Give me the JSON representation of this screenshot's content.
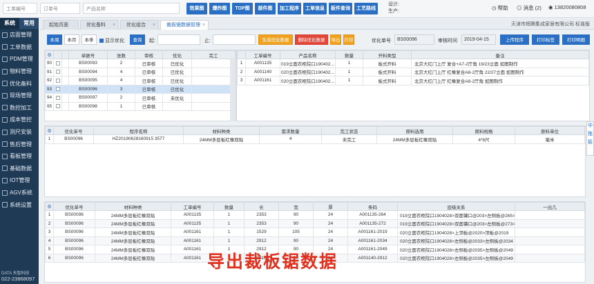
{
  "topbar": {
    "search_order_placeholder": "工单编号",
    "search_order_no_placeholder": "订单号",
    "search_product_placeholder": "产品名称",
    "buttons": [
      "效果图",
      "爆炸图",
      "TOP图",
      "部件图",
      "加工程序",
      "工单信息",
      "板件查询",
      "工艺路线"
    ],
    "design_label": "设计:",
    "production_label": "生产:",
    "help": "帮助",
    "messages": "消息 (2)",
    "user": "13820080808"
  },
  "sidebar": {
    "tabs": [
      "系统",
      "常用"
    ],
    "items": [
      "店面管理",
      "工单数据",
      "PDM管理",
      "物料管理",
      "优化备料",
      "现场管理",
      "数控加工",
      "成本管控",
      "测尺安装",
      "售后管理",
      "看板管理",
      "基础数据",
      "IOT管理",
      "AGV系统",
      "系统设置"
    ],
    "brand": "DATA 天智科技",
    "phone": "022-23868097"
  },
  "tabs": {
    "items": [
      "起始页面",
      "优化备料",
      "优化组合",
      "裁板锯数据管理"
    ],
    "active_index": 3,
    "company": "天津市辉腾集成家居有限公司  标准版"
  },
  "filter": {
    "btn_today": "本周",
    "btn_month": "本月",
    "btn_quarter": "本季",
    "show_optimized_label": "显示优化",
    "btn_query": "查询",
    "from_label": "起:",
    "to_label": "止:",
    "btn_import": "生成优化数据",
    "btn_delete": "删除优化数据",
    "btn_print1": "导出",
    "btn_print2": "打印",
    "opt_no_label": "优化单号",
    "opt_no_value": "BS00096",
    "audit_date_label": "审核时间",
    "audit_date_value": "2019-04-15",
    "btn_upload": "上传程序",
    "btn_print_label": "打印标签",
    "btn_print_list": "打印明细"
  },
  "table1": {
    "headers": [
      "单据号",
      "张数",
      "审核",
      "优化",
      "完工"
    ],
    "rows": [
      {
        "idx": "90",
        "no": "BS00093",
        "qty": "2",
        "audit": "已审核",
        "opt": "已优化",
        "done": ""
      },
      {
        "idx": "91",
        "no": "BS00094",
        "qty": "4",
        "audit": "已审核",
        "opt": "已优化",
        "done": ""
      },
      {
        "idx": "92",
        "no": "BS00095",
        "qty": "4",
        "audit": "已审核",
        "opt": "已优化",
        "done": ""
      },
      {
        "idx": "93",
        "no": "BS00096",
        "qty": "3",
        "audit": "已审核",
        "opt": "已优化",
        "done": ""
      },
      {
        "idx": "94",
        "no": "BS00097",
        "qty": "2",
        "audit": "已审核",
        "opt": "未优化",
        "done": ""
      },
      {
        "idx": "95",
        "no": "BS00098",
        "qty": "1",
        "audit": "已审核",
        "opt": "",
        "done": ""
      }
    ],
    "selected_index": 3
  },
  "table2": {
    "headers": [
      "工单编号",
      "产品名称",
      "数量",
      "开料类型",
      "备注"
    ],
    "rows": [
      {
        "idx": "1",
        "order": "A001135",
        "product": "019立面衣柜院口190402...",
        "qty": "1",
        "type": "板式开料",
        "note": "北京大红门上厅 复合+A7-2厅角 19/23立面 如图制作"
      },
      {
        "idx": "2",
        "order": "A001140",
        "product": "020立面衣柜院口190402...",
        "qty": "1",
        "type": "板式开料",
        "note": "北京大红门上厅 红橡复合A8-2厅角 22/27立面 如图制作"
      },
      {
        "idx": "3",
        "order": "A001161",
        "product": "020立面衣柜院口190402...",
        "qty": "1",
        "type": "板式开料",
        "note": "北京大红门上厅 红橡复合A8-2厅角 如图制作"
      }
    ]
  },
  "table3": {
    "headers": [
      "优化单号",
      "程序名称",
      "材料种类",
      "需求数量",
      "完工状态",
      "原料选用",
      "原料规格",
      "原料单位"
    ],
    "rows": [
      {
        "idx": "1",
        "opt": "BS00096",
        "prog": "HZ20190628160915 3577",
        "mat": "24MM多层板红橡双贴",
        "qty": "4",
        "status": "未完工",
        "raw": "24MM多层板红橡双贴",
        "spec": "4*8尺",
        "unit": "毫米"
      }
    ]
  },
  "table4": {
    "headers": [
      "优化单号",
      "材料种类",
      "工单编号",
      "数量",
      "长",
      "宽",
      "厚",
      "条码",
      "层级关系",
      "一出几"
    ],
    "rows": [
      {
        "idx": "1",
        "opt": "BS00096",
        "mat": "24MM多层板红橡双贴",
        "order": "A001135",
        "qty": "1",
        "l": "2353",
        "w": "90",
        "t": "24",
        "code": "A001135-264",
        "rel": "019立面衣柜院口1904028>双面镶口@203>左侧板@265>"
      },
      {
        "idx": "2",
        "opt": "BS00096",
        "mat": "24MM多层板红橡双贴",
        "order": "A001135",
        "qty": "1",
        "l": "2353",
        "w": "90",
        "t": "24",
        "code": "A001135-272",
        "rel": "019立面衣柜院口1904028>双面镶口@203>左侧板@273>"
      },
      {
        "idx": "3",
        "opt": "BS00096",
        "mat": "24MM多层板红橡双贴",
        "order": "A001161",
        "qty": "1",
        "l": "1529",
        "w": "105",
        "t": "24",
        "code": "A001161-2019",
        "rel": "020立面衣柜院口1904028>上顶板@2020>顶板@2019"
      },
      {
        "idx": "4",
        "opt": "BS00096",
        "mat": "24MM多层板红橡双贴",
        "order": "A001161",
        "qty": "1",
        "l": "2912",
        "w": "90",
        "t": "24",
        "code": "A001161-2034",
        "rel": "020立面衣柜院口1904028>左侧板@2033>左侧板@2034"
      },
      {
        "idx": "5",
        "opt": "BS00096",
        "mat": "24MM多层板红橡双贴",
        "order": "A001161",
        "qty": "1",
        "l": "2912",
        "w": "90",
        "t": "24",
        "code": "A001161-2049",
        "rel": "020立面衣柜院口1904028>左侧板@2035>左侧板@2049"
      },
      {
        "idx": "6",
        "opt": "BS00096",
        "mat": "24MM多层板红橡双贴",
        "order": "A001161",
        "qty": "1",
        "l": "2912",
        "w": "90",
        "t": "24",
        "code": "A001140-2912",
        "rel": "020立面衣柜院口1904028>左侧板@2035>左侧板@2049"
      }
    ]
  },
  "overlay_caption": "导出裁板锯数据",
  "rightbar": [
    "中",
    "拖",
    "扳"
  ],
  "colors": {
    "accent": "#2a6fc4",
    "sidebar": "#1f3a55",
    "overlay": "#e0301e"
  }
}
